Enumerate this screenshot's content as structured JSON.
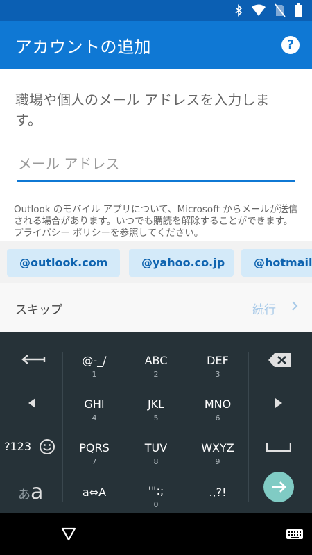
{
  "app_bar": {
    "title": "アカウントの追加",
    "help": "?"
  },
  "content": {
    "prompt": "職場や個人のメール アドレスを入力します。",
    "email_placeholder": "メール アドレス",
    "disclaimer": "Outlook のモバイル アプリについて、Microsoft からメールが送信される場合があります。いつでも購読を解除することができます。プライバシー ポリシーを参照してください。"
  },
  "suggestions": [
    "@outlook.com",
    "@yahoo.co.jp",
    "@hotmail."
  ],
  "actions": {
    "skip": "スキップ",
    "continue": "続行"
  },
  "keyboard": {
    "rows": [
      [
        {
          "main": "@-_/",
          "sub": "1"
        },
        {
          "main": "ABC",
          "sub": "2"
        },
        {
          "main": "DEF",
          "sub": "3"
        }
      ],
      [
        {
          "main": "GHI",
          "sub": "4"
        },
        {
          "main": "JKL",
          "sub": "5"
        },
        {
          "main": "MNO",
          "sub": "6"
        }
      ],
      [
        {
          "main": "PQRS",
          "sub": "7"
        },
        {
          "main": "TUV",
          "sub": "8"
        },
        {
          "main": "WXYZ",
          "sub": "9"
        }
      ],
      [
        {
          "main": "a⇔A",
          "sub": ""
        },
        {
          "main": "'\":;",
          "sub": "0"
        },
        {
          "main": ".,?!",
          "sub": ""
        }
      ]
    ],
    "symbols_label": "?123",
    "kana_label": "あ",
    "alpha_label": "a"
  },
  "colors": {
    "status_bar": "#0b5fb3",
    "app_bar": "#0f78d4",
    "chip_bg": "#d4eaf9",
    "keyboard_bg": "#263238",
    "enter_key": "#80cbc4"
  }
}
